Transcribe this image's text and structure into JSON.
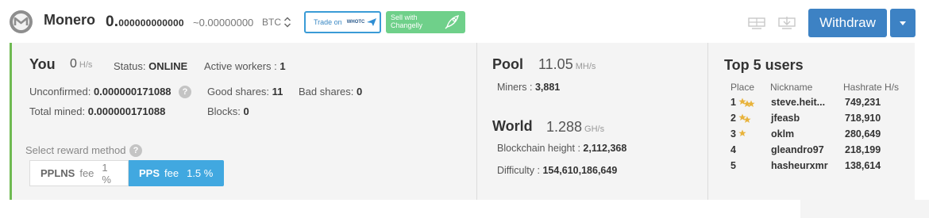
{
  "header": {
    "coin_name": "Monero",
    "balance_main": "0.",
    "balance_rest": "000000000000",
    "approx_btc": "~0.00000000",
    "btc_label": "BTC",
    "trade_label": "Trade on",
    "trade_brand": "WHOTC",
    "changelly_label": "Sell with Changelly",
    "withdraw_label": "Withdraw",
    "icons": [
      "logo-icon",
      "sort-icon",
      "rocket-icon",
      "miner-icon",
      "miner-download-icon",
      "caret-down-icon"
    ]
  },
  "you": {
    "title": "You",
    "hashrate": "0",
    "hashrate_unit": "H/s",
    "status_label": "Status:",
    "status_value": "ONLINE",
    "workers_label": "Active workers",
    "workers_value": "1",
    "unconfirmed_label": "Unconfirmed:",
    "unconfirmed_value": "0.000000171088",
    "good_shares_label": "Good shares:",
    "good_shares_value": "11",
    "bad_shares_label": "Bad shares:",
    "bad_shares_value": "0",
    "total_mined_label": "Total mined:",
    "total_mined_value": "0.000000171088",
    "blocks_label": "Blocks:",
    "blocks_value": "0",
    "reward_method_label": "Select reward method",
    "methods": [
      {
        "name": "PPLNS",
        "fee_label": "fee",
        "fee": "1 %",
        "selected": false
      },
      {
        "name": "PPS",
        "fee_label": "fee",
        "fee": "1.5 %",
        "selected": true
      }
    ]
  },
  "pool": {
    "title": "Pool",
    "hashrate": "11.05",
    "hashrate_unit": "MH/s",
    "miners_label": "Miners",
    "miners_value": "3,881"
  },
  "world": {
    "title": "World",
    "hashrate": "1.288",
    "hashrate_unit": "GH/s",
    "height_label": "Blockchain height",
    "height_value": "2,112,368",
    "difficulty_label": "Difficulty",
    "difficulty_value": "154,610,186,649"
  },
  "top_users": {
    "title": "Top 5 users",
    "columns": [
      "Place",
      "Nickname",
      "Hashrate H/s"
    ],
    "rows": [
      {
        "place": "1",
        "stars": 3,
        "nickname": "steve.heit...",
        "hashrate": "749,231"
      },
      {
        "place": "2",
        "stars": 2,
        "nickname": "jfeasb",
        "hashrate": "718,910"
      },
      {
        "place": "3",
        "stars": 1,
        "nickname": "oklm",
        "hashrate": "280,649"
      },
      {
        "place": "4",
        "stars": 0,
        "nickname": "gleandro97",
        "hashrate": "218,199"
      },
      {
        "place": "5",
        "stars": 0,
        "nickname": "hasheurxmr",
        "hashrate": "138,614"
      }
    ]
  },
  "colors": {
    "accent_blue": "#3d82c4",
    "toggle_blue": "#41a8e0",
    "changelly_green": "#6fd08a",
    "online_bar_green": "#6fba52",
    "star_gold": "#e8b33b"
  }
}
